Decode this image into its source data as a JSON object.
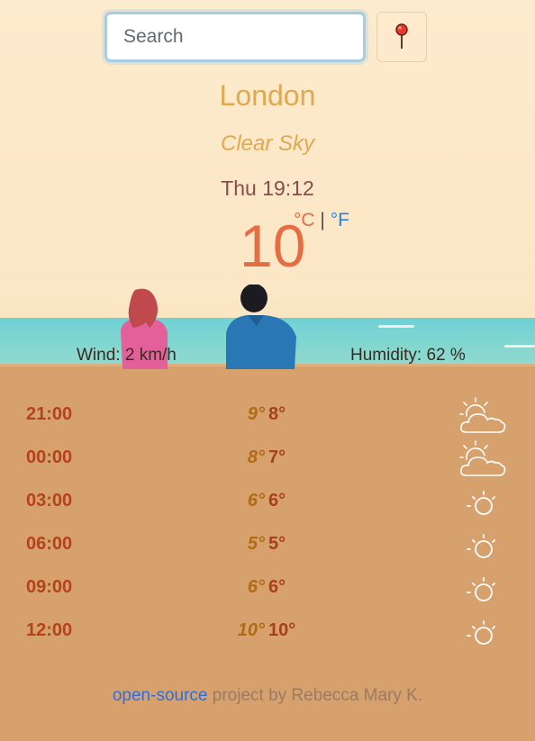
{
  "search": {
    "placeholder": "Search"
  },
  "icons": {
    "location": "map-pin-icon",
    "cloudy": "partly-cloudy-icon",
    "sunny": "sun-icon"
  },
  "weather": {
    "city": "London",
    "description": "Clear Sky",
    "datetime": "Thu 19:12",
    "temperature": "10",
    "unit_c": "°C",
    "unit_sep": "|",
    "unit_f": "°F",
    "wind": "Wind: 2 km/h",
    "humidity": "Humidity: 62 %"
  },
  "forecast": [
    {
      "hour": "21:00",
      "max": "9°",
      "min": "8°",
      "icon": "partly-cloudy-icon"
    },
    {
      "hour": "00:00",
      "max": "8°",
      "min": "7°",
      "icon": "partly-cloudy-icon"
    },
    {
      "hour": "03:00",
      "max": "6°",
      "min": "6°",
      "icon": "sun-icon"
    },
    {
      "hour": "06:00",
      "max": "5°",
      "min": "5°",
      "icon": "sun-icon"
    },
    {
      "hour": "09:00",
      "max": "6°",
      "min": "6°",
      "icon": "sun-icon"
    },
    {
      "hour": "12:00",
      "max": "10°",
      "min": "10°",
      "icon": "sun-icon"
    }
  ],
  "footer": {
    "link": "open-source",
    "text": " project by Rebecca Mary K."
  },
  "colors": {
    "accent": "#e0a84f",
    "temperature": "#e66d43",
    "link": "#2b6ee0",
    "hour": "#b5421f"
  }
}
